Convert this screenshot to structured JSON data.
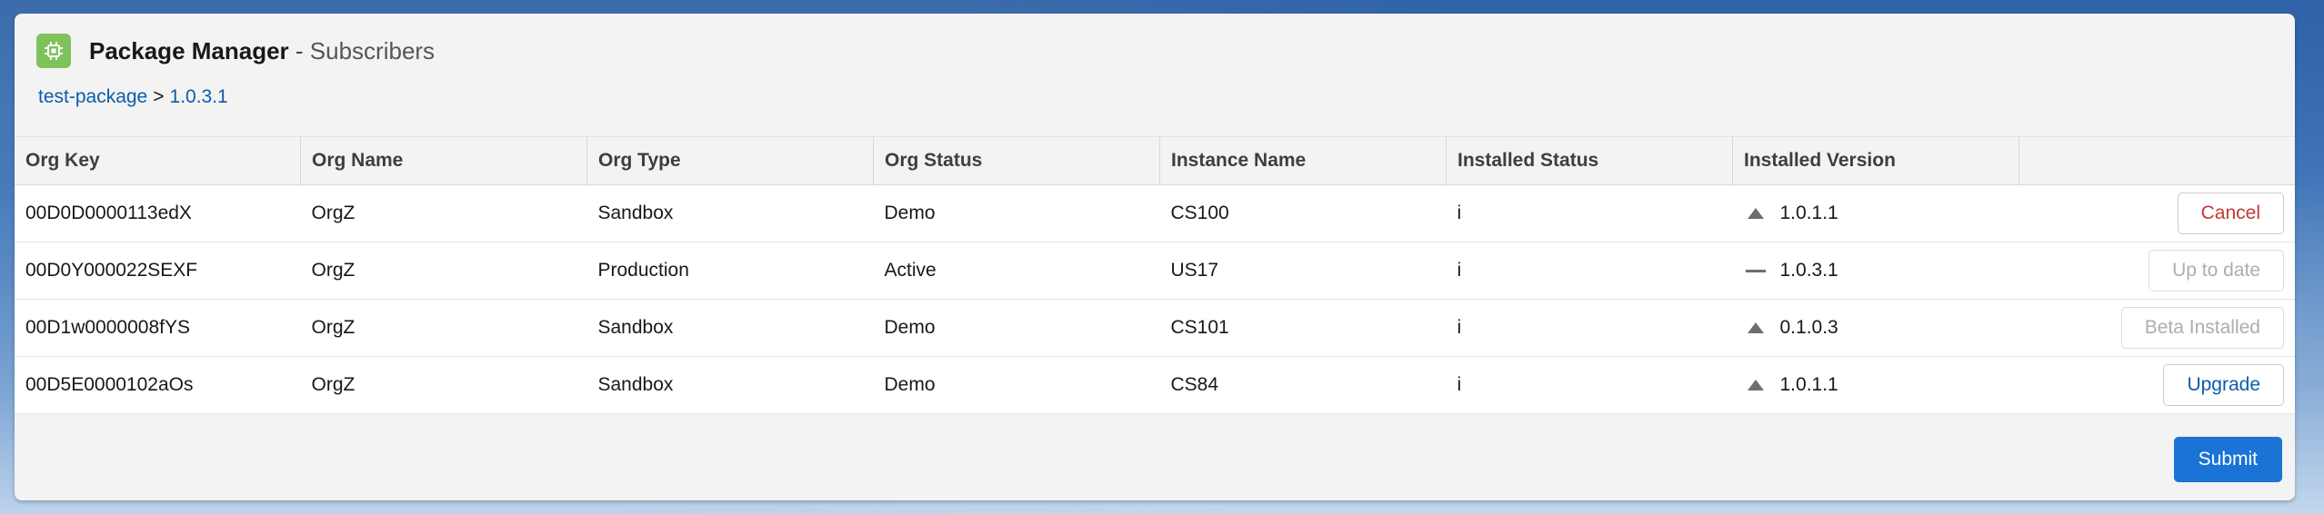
{
  "header": {
    "title_main": "Package Manager",
    "title_separator": " - ",
    "title_sub": "Subscribers",
    "icon": "chip-icon"
  },
  "breadcrumb": {
    "package": "test-package",
    "separator": ">",
    "version": "1.0.3.1"
  },
  "table": {
    "columns": [
      "Org Key",
      "Org Name",
      "Org Type",
      "Org Status",
      "Instance Name",
      "Installed Status",
      "Installed Version",
      ""
    ],
    "rows": [
      {
        "org_key": "00D0D0000113edX",
        "org_name": "OrgZ",
        "org_type": "Sandbox",
        "org_status": "Demo",
        "instance": "CS100",
        "installed_status": "i",
        "version_icon": "triangle-up-icon",
        "installed_version": "1.0.1.1",
        "action": "Cancel",
        "action_style": "cancel"
      },
      {
        "org_key": "00D0Y000022SEXF",
        "org_name": "OrgZ",
        "org_type": "Production",
        "org_status": "Active",
        "instance": "US17",
        "installed_status": "i",
        "version_icon": "dash-icon",
        "installed_version": "1.0.3.1",
        "action": "Up to date",
        "action_style": "disabled"
      },
      {
        "org_key": "00D1w0000008fYS",
        "org_name": "OrgZ",
        "org_type": "Sandbox",
        "org_status": "Demo",
        "instance": "CS101",
        "installed_status": "i",
        "version_icon": "triangle-up-icon",
        "installed_version": "0.1.0.3",
        "action": "Beta Installed",
        "action_style": "disabled"
      },
      {
        "org_key": "00D5E0000102aOs",
        "org_name": "OrgZ",
        "org_type": "Sandbox",
        "org_status": "Demo",
        "instance": "CS84",
        "installed_status": "i",
        "version_icon": "triangle-up-icon",
        "installed_version": "1.0.1.1",
        "action": "Upgrade",
        "action_style": "upgrade"
      }
    ]
  },
  "footer": {
    "submit_label": "Submit"
  },
  "colors": {
    "brand_blue": "#1b73d5",
    "link_blue": "#0b5cab",
    "cancel_red": "#c23934",
    "app_icon_green": "#7fc15b"
  }
}
